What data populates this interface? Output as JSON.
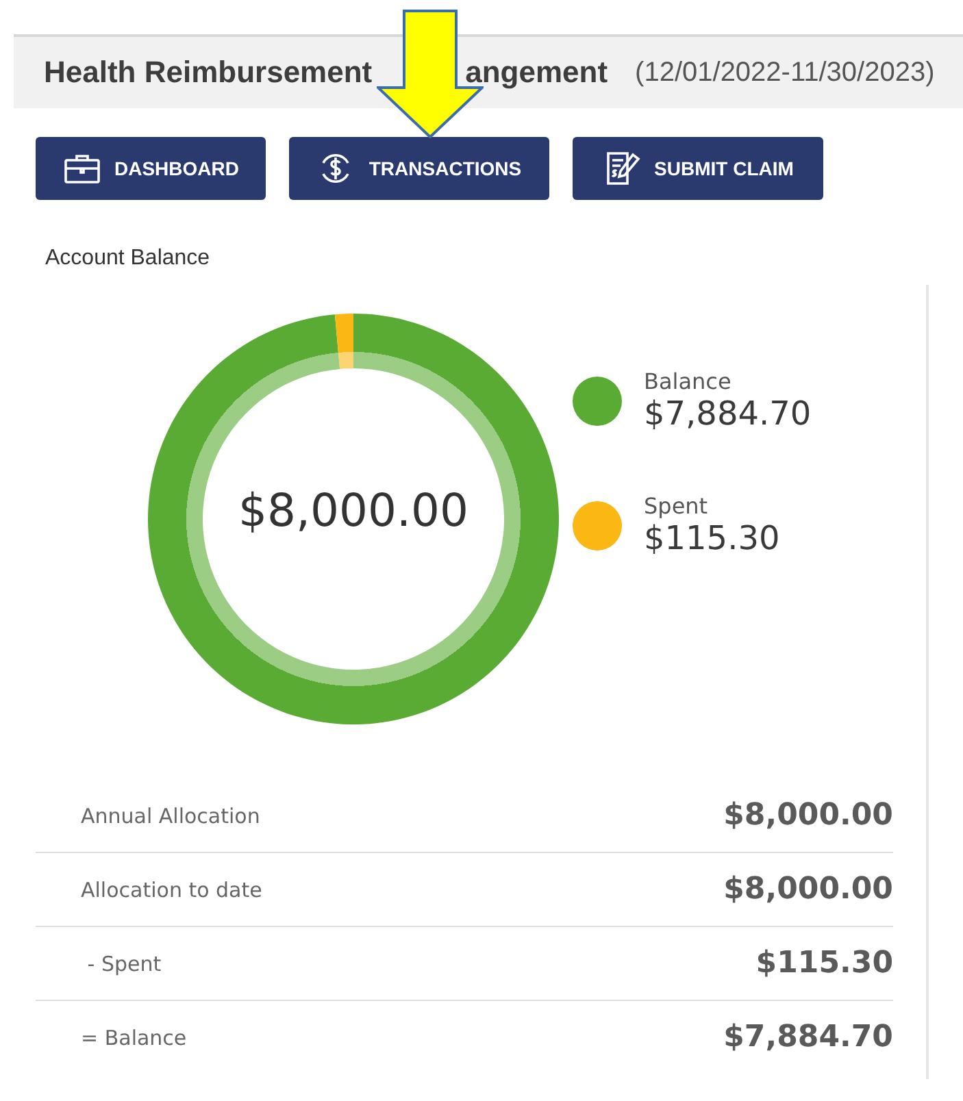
{
  "header": {
    "title_parts": [
      "Health Reimbursement",
      "angement"
    ],
    "period": "(12/01/2022-11/30/2023)"
  },
  "buttons": [
    {
      "label": "DASHBOARD",
      "kind": "briefcase"
    },
    {
      "label": "TRANSACTIONS",
      "kind": "dollar"
    },
    {
      "label": "SUBMIT CLAIM",
      "kind": "claim"
    }
  ],
  "account_balance": {
    "title": "Account Balance",
    "total": "$8,000.00",
    "chart_data": {
      "type": "donut",
      "categories": [
        "Balance",
        "Spent"
      ],
      "values": [
        98.56,
        1.44
      ]
    },
    "legend": [
      {
        "amount": "$7,884.70",
        "color": "#5aab33"
      },
      {
        "amount": "$115.30",
        "color": "#fbb714"
      }
    ]
  },
  "summary": [
    {
      "label": "Annual Allocation",
      "amount": "$8,000.00"
    },
    {
      "label": "Allocation to date",
      "amount": "$8,000.00"
    },
    {
      "label": " - Spent",
      "amount": "$115.30"
    },
    {
      "label": "= Balance",
      "amount": "$7,884.70"
    }
  ]
}
